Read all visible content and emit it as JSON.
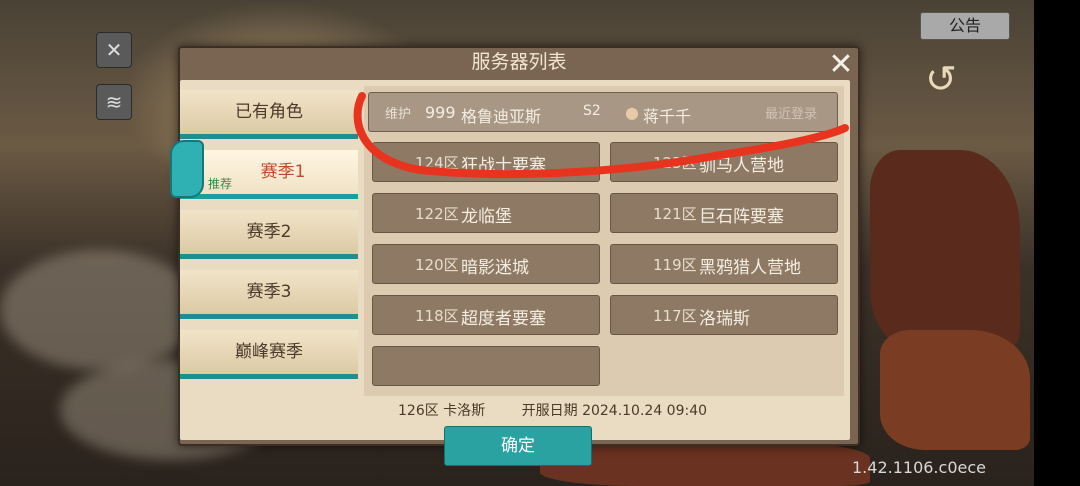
{
  "top": {
    "notice_label": "公告"
  },
  "icons": {
    "tools": "tools-icon",
    "rss": "rss-icon",
    "back": "back-arrow-icon",
    "close": "close-icon"
  },
  "dialog": {
    "title": "服务器列表",
    "tabs": [
      {
        "label": "已有角色",
        "badge": ""
      },
      {
        "label": "赛季1",
        "badge": "推荐"
      },
      {
        "label": "赛季2",
        "badge": ""
      },
      {
        "label": "赛季3",
        "badge": ""
      },
      {
        "label": "巅峰赛季",
        "badge": ""
      }
    ],
    "recent": {
      "status": "维护",
      "id": "999",
      "name": "格鲁迪亚斯",
      "season": "S2",
      "player": "蒋千千",
      "tag": "最近登录"
    },
    "servers": [
      {
        "zone": "124区",
        "name": "狂战士要塞"
      },
      {
        "zone": "123区",
        "name": "驯马人营地"
      },
      {
        "zone": "122区",
        "name": "龙临堡"
      },
      {
        "zone": "121区",
        "name": "巨石阵要塞"
      },
      {
        "zone": "120区",
        "name": "暗影迷城"
      },
      {
        "zone": "119区",
        "name": "黑鸦猎人营地"
      },
      {
        "zone": "118区",
        "name": "超度者要塞"
      },
      {
        "zone": "117区",
        "name": "洛瑞斯"
      }
    ],
    "footer": {
      "server": "126区 卡洛斯",
      "open_date": "开服日期 2024.10.24 09:40"
    },
    "confirm_label": "确定"
  },
  "version": "1.42.1106.c0ece",
  "colors": {
    "annotation": "#e8331f",
    "accent": "#2aa2a2"
  }
}
